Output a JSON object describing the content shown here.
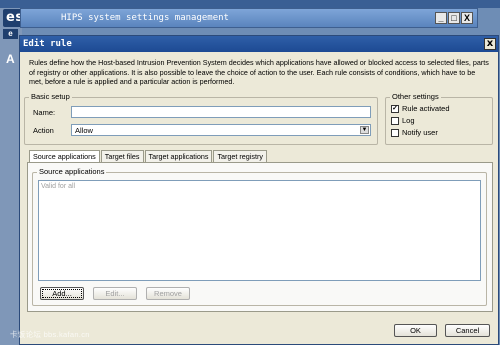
{
  "background": {
    "logo": "eset",
    "side_letter_e": "e",
    "side_letter_a": "A",
    "hips_window_title": "HIPS system settings management",
    "window_controls": [
      "_",
      "□",
      "X"
    ]
  },
  "dialog": {
    "title": "Edit rule",
    "close_label": "x",
    "description": "Rules define how the Host-based Intrusion Prevention System decides which applications have allowed or blocked access to selected files, parts of registry or other applications. It is also possible to leave the choice of action to the user. Each rule consists of conditions, which have to be met, before a rule is applied and a particular action is performed.",
    "basic_setup": {
      "legend": "Basic setup",
      "name_label": "Name:",
      "name_value": "",
      "action_label": "Action",
      "action_value": "Allow",
      "dropdown_arrow": "▼"
    },
    "other_settings": {
      "legend": "Other settings",
      "rule_activated": {
        "label": "Rule activated",
        "checked": true,
        "mark": "✓"
      },
      "log": {
        "label": "Log",
        "checked": false
      },
      "notify_user": {
        "label": "Notify user",
        "checked": false
      }
    },
    "tabs": [
      {
        "label": "Source applications",
        "active": true
      },
      {
        "label": "Target files",
        "active": false
      },
      {
        "label": "Target applications",
        "active": false
      },
      {
        "label": "Target registry",
        "active": false
      }
    ],
    "source_group": {
      "legend": "Source applications",
      "list_items": [
        "Valid for all"
      ]
    },
    "buttons": {
      "add": "Add...",
      "edit": "Edit...",
      "remove": "Remove",
      "ok": "OK",
      "cancel": "Cancel"
    }
  },
  "watermark": "卡饭论坛 bbs.kafan.cn"
}
